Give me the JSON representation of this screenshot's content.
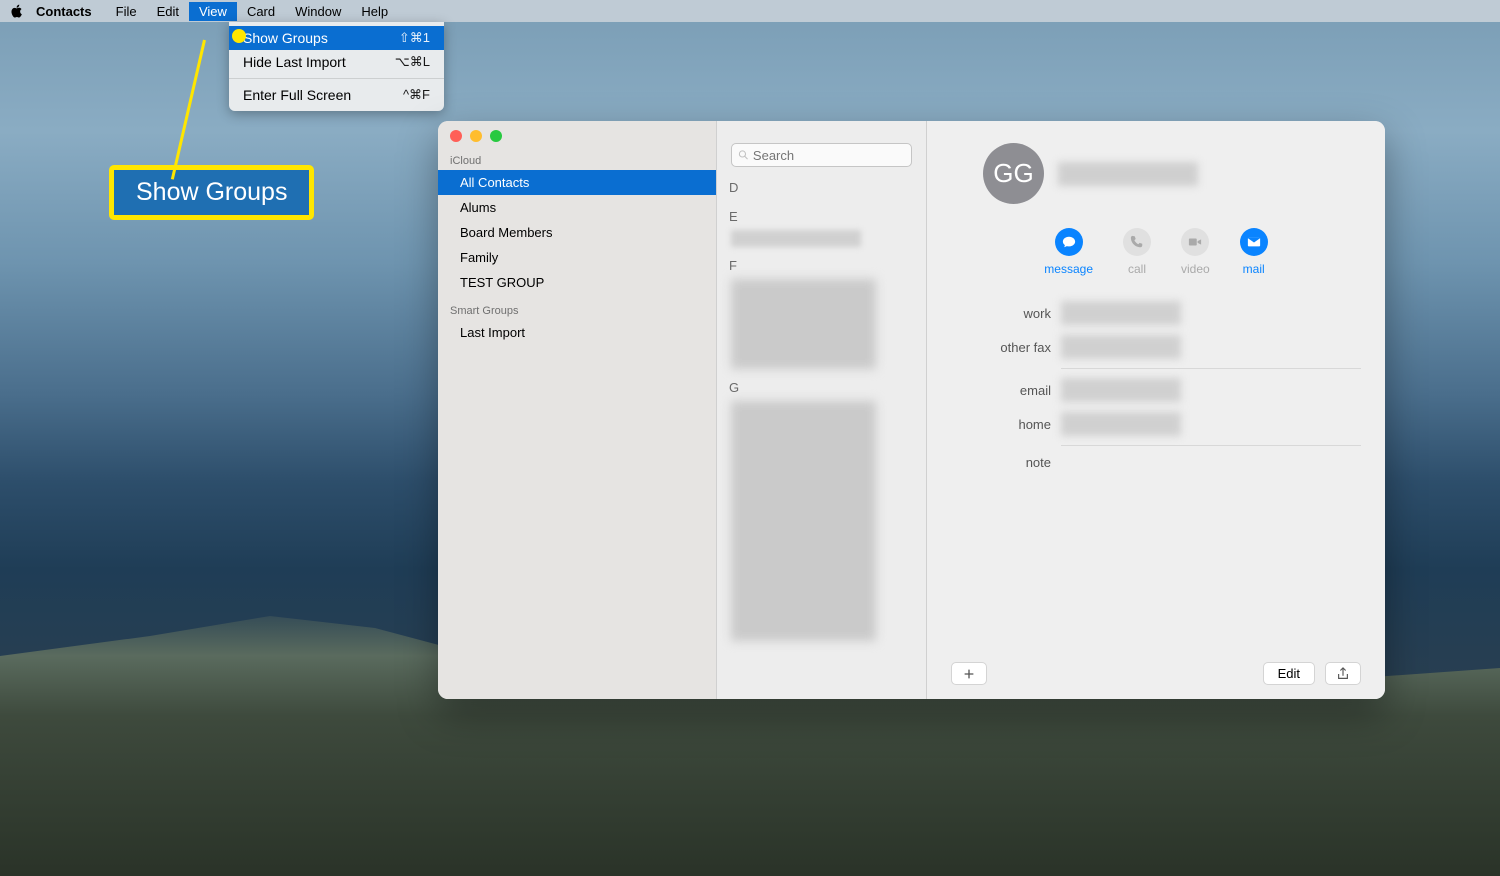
{
  "menubar": {
    "app_name": "Contacts",
    "items": [
      "File",
      "Edit",
      "View",
      "Card",
      "Window",
      "Help"
    ],
    "active_index": 2
  },
  "dropdown": {
    "items": [
      {
        "label": "Show Groups",
        "shortcut": "⇧⌘1",
        "highlighted": true
      },
      {
        "label": "Hide Last Import",
        "shortcut": "⌥⌘L",
        "highlighted": false
      }
    ],
    "items2": [
      {
        "label": "Enter Full Screen",
        "shortcut": "^⌘F",
        "highlighted": false
      }
    ]
  },
  "callout": {
    "label": "Show Groups"
  },
  "sidebar": {
    "section1_header": "iCloud",
    "groups": [
      "All Contacts",
      "Alums",
      "Board Members",
      "Family",
      "TEST GROUP"
    ],
    "selected_index": 0,
    "section2_header": "Smart Groups",
    "smart_groups": [
      "Last Import"
    ]
  },
  "list": {
    "search_placeholder": "Search",
    "sections": [
      "D",
      "E",
      "F",
      "G"
    ]
  },
  "detail": {
    "initials": "GG",
    "actions": [
      {
        "label": "message",
        "active": true
      },
      {
        "label": "call",
        "active": false
      },
      {
        "label": "video",
        "active": false
      },
      {
        "label": "mail",
        "active": true
      }
    ],
    "fields": {
      "work": "work",
      "other_fax": "other fax",
      "email": "email",
      "home": "home",
      "note": "note"
    },
    "add_btn": "+",
    "edit_btn": "Edit"
  }
}
